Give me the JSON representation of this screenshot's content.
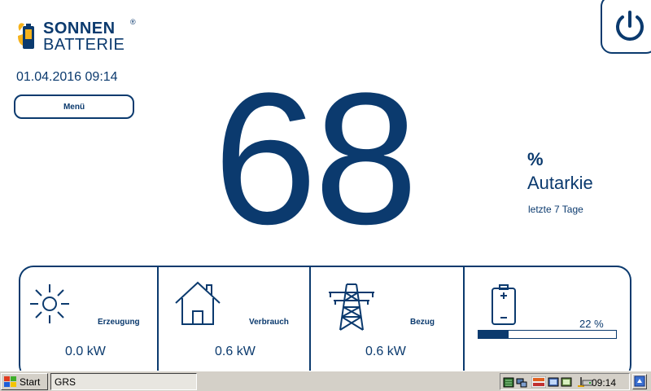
{
  "brand": {
    "line1": "SONNEN",
    "line2": "BATTERIE",
    "reg": "®"
  },
  "header": {
    "datetime": "01.04.2016 09:14",
    "menu_label": "Menü"
  },
  "main": {
    "value": "68",
    "unit": "%",
    "metric": "Autarkie",
    "period": "letzte 7 Tage"
  },
  "tiles": {
    "production": {
      "label": "Erzeugung",
      "value": "0.0 kW",
      "icon": "sun-icon"
    },
    "consumption": {
      "label": "Verbrauch",
      "value": "0.6 kW",
      "icon": "house-icon"
    },
    "grid": {
      "label": "Bezug",
      "value": "0.6 kW",
      "icon": "power-pylon-icon"
    },
    "battery": {
      "percent_text": "22 %",
      "level": 0.22,
      "icon": "battery-icon"
    }
  },
  "taskbar": {
    "start_label": "Start",
    "task": "GRS",
    "clock": "09:14"
  },
  "colors": {
    "accent": "#0b3a6e",
    "taskbar": "#d4d0c8"
  }
}
